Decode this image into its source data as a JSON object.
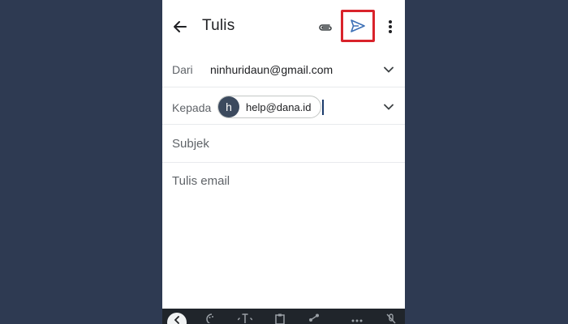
{
  "header": {
    "title": "Tulis"
  },
  "from": {
    "label": "Dari",
    "value": "ninhuridaun@gmail.com"
  },
  "to": {
    "label": "Kepada",
    "recipients": [
      {
        "initial": "h",
        "email": "help@dana.id"
      }
    ]
  },
  "subject": {
    "placeholder": "Subjek"
  },
  "body": {
    "placeholder": "Tulis email"
  },
  "icons": {
    "back": "arrow-left-icon",
    "attach": "paperclip-icon",
    "send": "send-icon",
    "more": "more-vert-icon"
  },
  "colors": {
    "highlight": "#d9232b",
    "send": "#3b6fb6",
    "background": "#2e3a52"
  }
}
